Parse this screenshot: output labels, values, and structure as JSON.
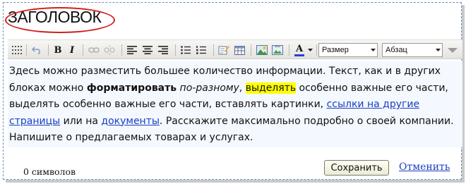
{
  "heading": {
    "text": "ЗАГОЛОВОК"
  },
  "toolbar": {
    "buttons": [
      {
        "name": "show-blocks-icon"
      },
      {
        "name": "undo-icon"
      },
      {
        "name": "bold-button",
        "label": "B"
      },
      {
        "name": "italic-button",
        "label": "I"
      },
      {
        "name": "link-icon"
      },
      {
        "name": "unlink-icon"
      },
      {
        "name": "align-left-icon"
      },
      {
        "name": "align-center-icon"
      },
      {
        "name": "align-right-icon"
      },
      {
        "name": "bulleted-list-icon"
      },
      {
        "name": "numbered-list-icon"
      },
      {
        "name": "edit-source-icon"
      },
      {
        "name": "table-icon"
      },
      {
        "name": "image-icon"
      },
      {
        "name": "font-color-button",
        "label": "A"
      }
    ],
    "size_select": {
      "value": "Размер"
    },
    "format_select": {
      "value": "Абзац"
    }
  },
  "content": {
    "text_1": "Здесь можно разместить большее количество информации. Текст, как и в других блоках можно ",
    "bold": "форматировать",
    "text_2": " ",
    "italic": "по-разному",
    "text_3": ", ",
    "highlight": "выделять",
    "text_4": " особенно важные его части, выделять особенно важные его части, вставлять картинки, ",
    "link_1": "ссылки на другие страницы",
    "text_5": " или на ",
    "link_2": "документы",
    "text_6": ". Расскажите максимально подробно о своей компании. Напишите о предлагаемых товарах и услугах."
  },
  "footer": {
    "counter": "0 символов",
    "save_label": "Сохранить",
    "cancel_label": "Отменить"
  },
  "colors": {
    "frame_border": "#6a8fbf",
    "title_oval": "#d21e1e",
    "highlight": "#ffff00",
    "link": "#1a3fbf",
    "content_bg": "#f4f8ff",
    "font_color_bar": "#2a3fd0"
  }
}
